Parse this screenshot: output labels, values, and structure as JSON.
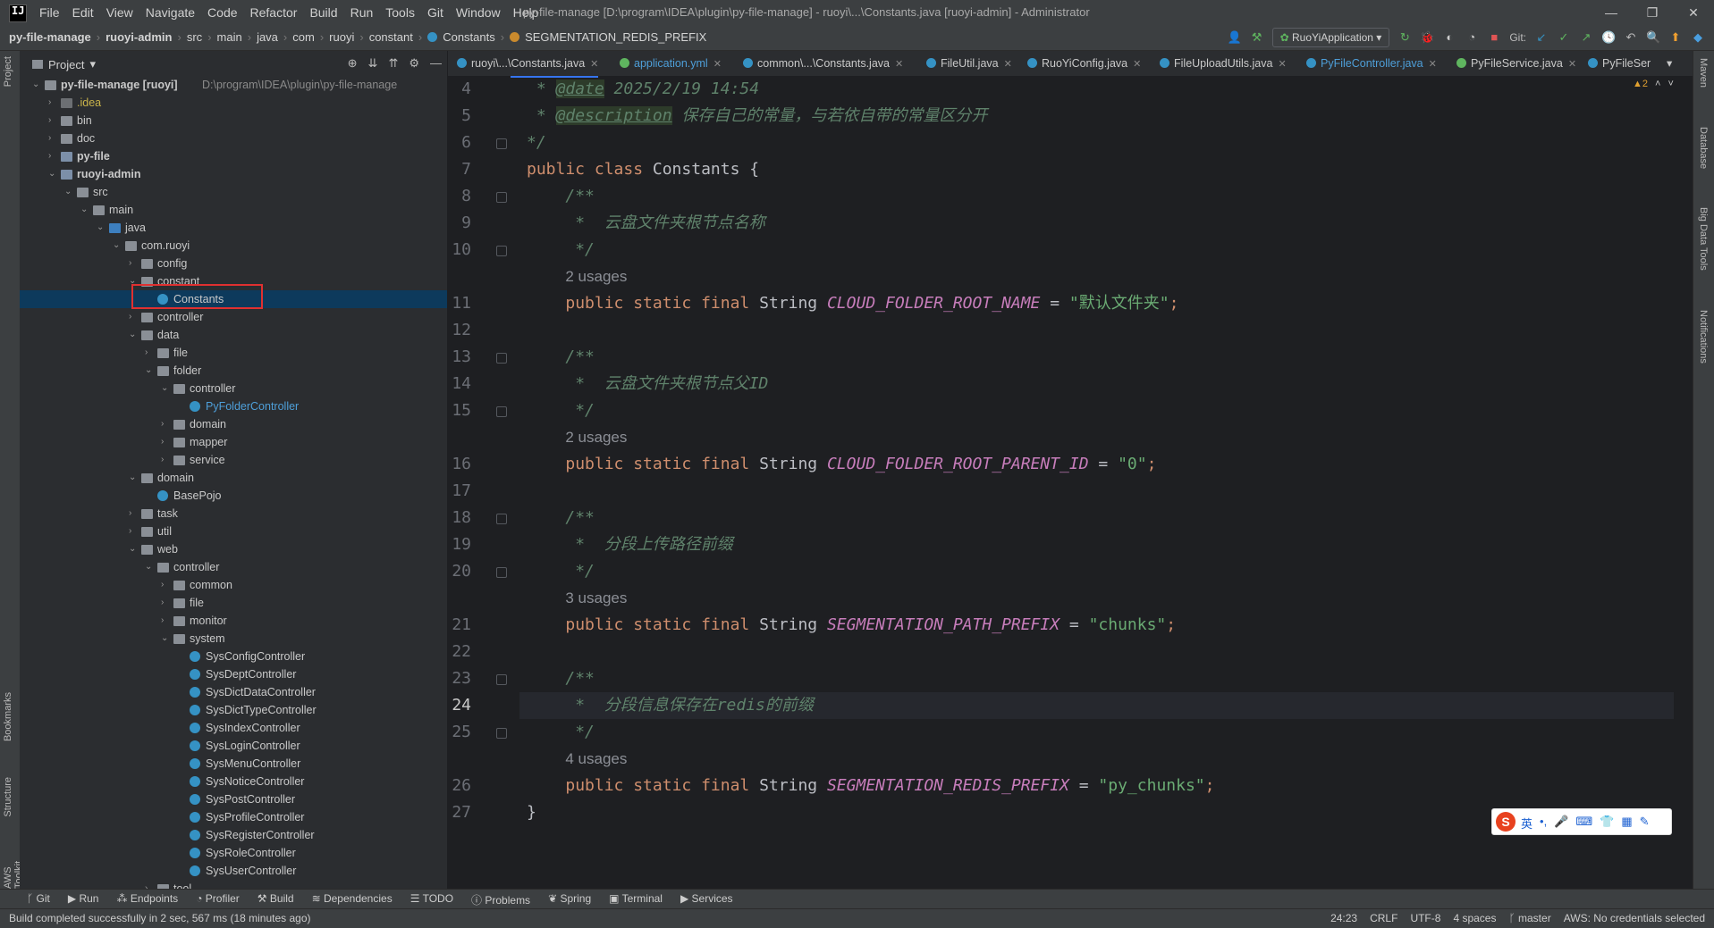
{
  "menubar": {
    "logo": "IJ",
    "items": [
      "File",
      "Edit",
      "View",
      "Navigate",
      "Code",
      "Refactor",
      "Build",
      "Run",
      "Tools",
      "Git",
      "Window",
      "Help"
    ],
    "title": "py-file-manage [D:\\program\\IDEA\\plugin\\py-file-manage] - ruoyi\\...\\Constants.java [ruoyi-admin] - Administrator",
    "controls": [
      "—",
      "❐",
      "✕"
    ]
  },
  "breadcrumbs": [
    "py-file-manage",
    "ruoyi-admin",
    "src",
    "main",
    "java",
    "com",
    "ruoyi",
    "constant",
    "Constants",
    "SEGMENTATION_REDIS_PREFIX"
  ],
  "toolbar": {
    "run_config": "RuoYiApplication",
    "git_label": "Git:"
  },
  "left_strip": {
    "project": "Project",
    "bookmarks": "Bookmarks",
    "structure": "Structure",
    "aws": "AWS Toolkit"
  },
  "right_strip": {
    "maven": "Maven",
    "database": "Database",
    "bigdata": "Big Data Tools",
    "notifications": "Notifications"
  },
  "project_panel": {
    "title": "Project",
    "rows": [
      {
        "label": "py-file-manage [ruoyi]",
        "path": "D:\\program\\IDEA\\plugin\\py-file-manage"
      },
      {
        "label": ".idea"
      },
      {
        "label": "bin"
      },
      {
        "label": "doc"
      },
      {
        "label": "py-file"
      },
      {
        "label": "ruoyi-admin"
      },
      {
        "label": "src"
      },
      {
        "label": "main"
      },
      {
        "label": "java"
      },
      {
        "label": "com.ruoyi"
      },
      {
        "label": "config"
      },
      {
        "label": "constant"
      },
      {
        "label": "Constants"
      },
      {
        "label": "controller"
      },
      {
        "label": "data"
      },
      {
        "label": "file"
      },
      {
        "label": "folder"
      },
      {
        "label": "controller"
      },
      {
        "label": "PyFolderController"
      },
      {
        "label": "domain"
      },
      {
        "label": "mapper"
      },
      {
        "label": "service"
      },
      {
        "label": "domain"
      },
      {
        "label": "BasePojo"
      },
      {
        "label": "task"
      },
      {
        "label": "util"
      },
      {
        "label": "web"
      },
      {
        "label": "controller"
      },
      {
        "label": "common"
      },
      {
        "label": "file"
      },
      {
        "label": "monitor"
      },
      {
        "label": "system"
      },
      {
        "label": "SysConfigController"
      },
      {
        "label": "SysDeptController"
      },
      {
        "label": "SysDictDataController"
      },
      {
        "label": "SysDictTypeController"
      },
      {
        "label": "SysIndexController"
      },
      {
        "label": "SysLoginController"
      },
      {
        "label": "SysMenuController"
      },
      {
        "label": "SysNoticeController"
      },
      {
        "label": "SysPostController"
      },
      {
        "label": "SysProfileController"
      },
      {
        "label": "SysRegisterController"
      },
      {
        "label": "SysRoleController"
      },
      {
        "label": "SysUserController"
      },
      {
        "label": "tool"
      }
    ]
  },
  "tabs": [
    "ruoyi\\...\\Constants.java",
    "application.yml",
    "common\\...\\Constants.java",
    "FileUtil.java",
    "RuoYiConfig.java",
    "FileUploadUtils.java",
    "PyFileController.java",
    "PyFileService.java",
    "PyFileSer"
  ],
  "inspection": {
    "warnings": "▲2"
  },
  "code": {
    "lines": [
      {
        "n": "4"
      },
      {
        "n": "5"
      },
      {
        "n": "6"
      },
      {
        "n": "7"
      },
      {
        "n": "8"
      },
      {
        "n": "9"
      },
      {
        "n": "10"
      },
      {
        "n": ""
      },
      {
        "n": "11"
      },
      {
        "n": "12"
      },
      {
        "n": "13"
      },
      {
        "n": "14"
      },
      {
        "n": "15"
      },
      {
        "n": ""
      },
      {
        "n": "16"
      },
      {
        "n": "17"
      },
      {
        "n": "18"
      },
      {
        "n": "19"
      },
      {
        "n": "20"
      },
      {
        "n": ""
      },
      {
        "n": "21"
      },
      {
        "n": "22"
      },
      {
        "n": "23"
      },
      {
        "n": "24"
      },
      {
        "n": "25"
      },
      {
        "n": ""
      },
      {
        "n": "26"
      },
      {
        "n": "27"
      }
    ],
    "date_tag": "@date",
    "date_val": " 2025/2/19 14:54",
    "desc_tag": "@description",
    "desc_val": " 保存自己的常量，与若依自带的常量区分开",
    "comment_end": "*/",
    "class_kw": "public class",
    "class_name": " Constants {",
    "doc_open": "/**",
    "doc_close": " */",
    "c1": " *  云盘文件夹根节点名称",
    "c2": " *  云盘文件夹根节点父ID",
    "c3": " *  分段上传路径前缀",
    "c4": " *  分段信息保存在redis的前缀",
    "usage2": "2 usages",
    "usage2b": "2 usages",
    "usage3": "3 usages",
    "usage4": "4 usages",
    "decl_kw": "public static final",
    "decl_ty": " String ",
    "f1": "CLOUD_FOLDER_ROOT_NAME",
    "v1": "\"默认文件夹\"",
    "f2": "CLOUD_FOLDER_ROOT_PARENT_ID",
    "v2": "\"0\"",
    "f3": "SEGMENTATION_PATH_PREFIX",
    "v3": "\"chunks\"",
    "f4": "SEGMENTATION_REDIS_PREFIX",
    "v4": "\"py_chunks\"",
    "eq": " = ",
    "semi": ";",
    "star": " * ",
    "close_brace": "}"
  },
  "bottom_tools": [
    "Git",
    "Run",
    "Endpoints",
    "Profiler",
    "Build",
    "Dependencies",
    "TODO",
    "Problems",
    "Spring",
    "Terminal",
    "Services"
  ],
  "status": {
    "message": "Build completed successfully in 2 sec, 567 ms (18 minutes ago)",
    "position": "24:23",
    "line_sep": "CRLF",
    "encoding": "UTF-8",
    "indent": "4 spaces",
    "branch": "master",
    "aws": "AWS: No credentials selected"
  },
  "ime": {
    "logo": "S",
    "lang": "英",
    "items": [
      "•,",
      "🎤",
      "⌨",
      "👕",
      "▦",
      "✎"
    ]
  }
}
